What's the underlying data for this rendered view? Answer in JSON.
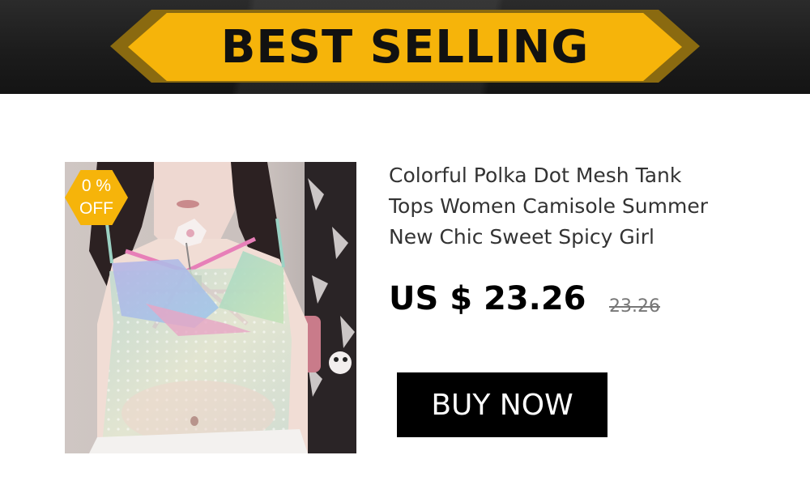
{
  "banner": {
    "title": "BEST SELLING",
    "accent_color": "#f6b40a"
  },
  "product": {
    "badge": {
      "line1": "0  %",
      "line2": "OFF"
    },
    "title_lines": [
      "Colorful Polka Dot Mesh Tank",
      "Tops Women Camisole Summer",
      "New Chic Sweet Spicy Girl"
    ],
    "price": "US $ 23.26",
    "old_price": "23.26",
    "buy_label": "BUY NOW"
  }
}
